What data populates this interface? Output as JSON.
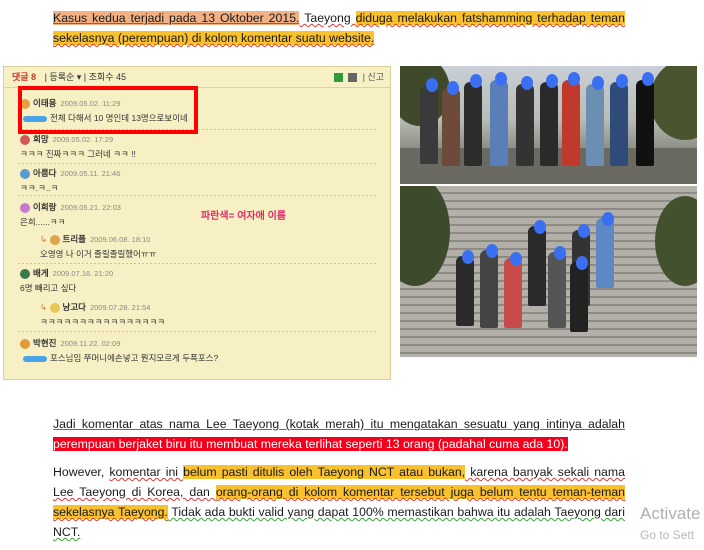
{
  "paragraph1": {
    "part1": "Kasus kedua terjadi pada 13 Oktober 2015.",
    "part2": " Taeyong ",
    "part3": "diduga melakukan fatshamming terhadap teman sekelasnya (perempuan) di kolom komentar suatu website."
  },
  "comments_screenshot": {
    "header_title": "댓글 8",
    "header_sort": "| 등록순 ▾ | 조회수 45",
    "header_right": "| 신고",
    "annotation": "파란색= 여자애 이름",
    "comments": [
      {
        "name": "이태용",
        "date": "2009.05.02. 11:29",
        "text": "전체 다해서 10 명인데 13명으로보이네"
      },
      {
        "name": "희망",
        "date": "2009.05.02. 17:29",
        "text": "ㅋㅋㅋ 진짜ㅋㅋㅋ 그러네 ㅋㅋ !!"
      },
      {
        "name": "아름다",
        "date": "2009.05.11. 21:46",
        "text": "ㅋㅋ.ㅋ..ㅋ"
      },
      {
        "name": "이희랑",
        "date": "2009.05.21. 22:03",
        "text": "은희......ㅋㅋ"
      },
      {
        "name": "트리플",
        "date": "2009.06.08. 18:10",
        "text": "오영영 나 이거 졸릴졸릴했어ㅠㅠ"
      },
      {
        "name": "배게",
        "date": "2009.07.16. 21:20",
        "text": "6명 빼리고 싶다"
      },
      {
        "name": "낭고다",
        "date": "2009.07.28. 21:54",
        "text": "ㅋㅋㅋㅋㅋㅋㅋㅋㅋㅋㅋㅋㅋㅋㅋㅋ"
      },
      {
        "name": "박현진",
        "date": "2009.11.22. 02:09",
        "text": "포스님임 쭈머니에손넣고 뭔지모르게 두폭포스?"
      }
    ]
  },
  "paragraph2": {
    "part1": "Jadi komentar atas nama Lee Taeyong (kotak merah) itu mengatakan sesuatu yang intinya adalah",
    "part2": "perempuan berjaket biru itu membuat mereka terlihat seperti 13 orang (padahal cuma ada 10)."
  },
  "paragraph3": {
    "part1": "However, ",
    "part2": "komentar ini ",
    "part3": "belum pasti ditulis oleh Taeyong NCT atau bukan,",
    "part4": " karena banyak sekali nama Lee Taeyong di Korea, dan ",
    "part5": "orang-orang di kolom komentar tersebut juga belum tentu teman-teman sekelasnya Taeyong.",
    "part6": " Tidak ada bukti valid yang dapat 100% memastikan bahwa itu adalah Taeyong dari NCT."
  },
  "watermark": {
    "line1": "Activate",
    "line2": "Go to Sett"
  },
  "colors": {
    "highlight_orange": "#f9c12e",
    "highlight_red": "#f2001c",
    "redbox": "#ff0000"
  }
}
